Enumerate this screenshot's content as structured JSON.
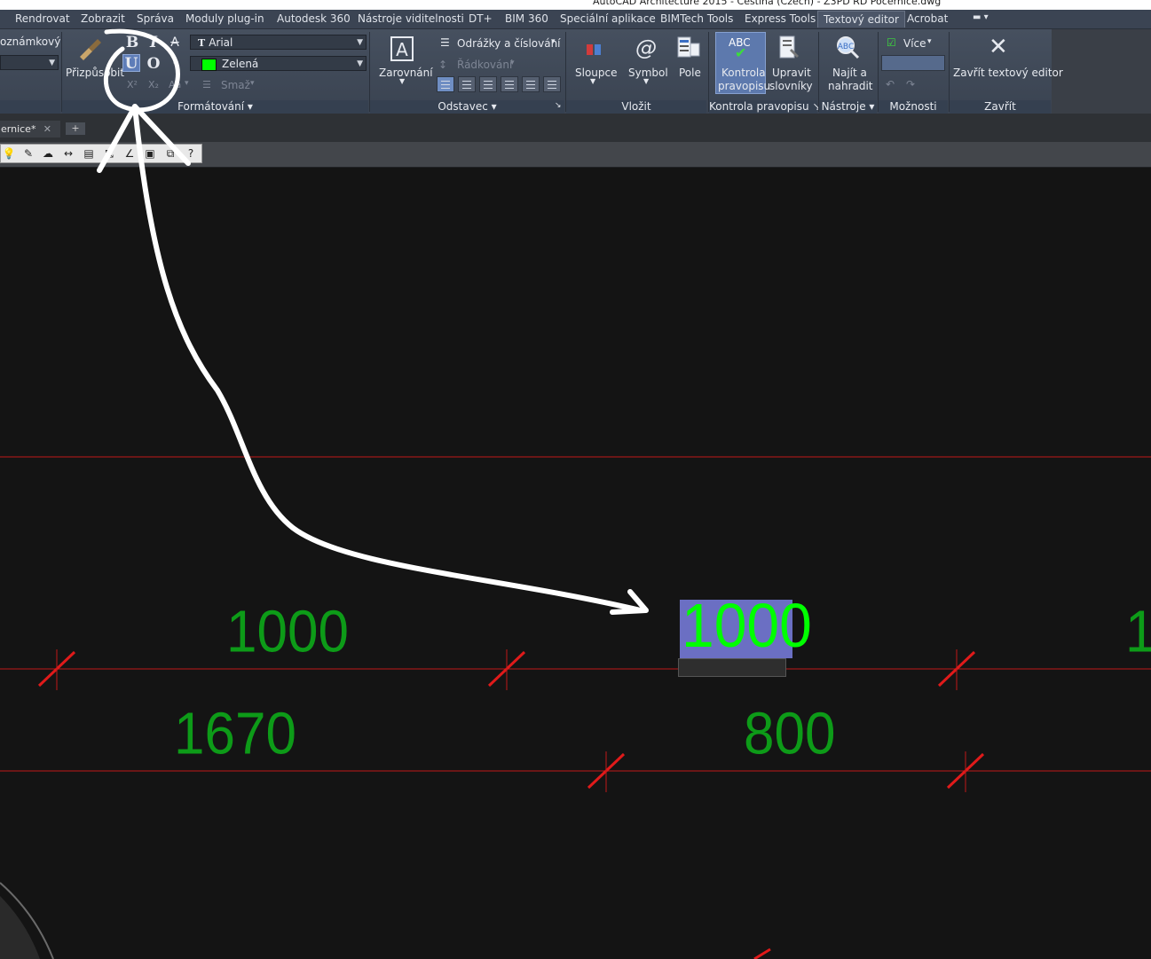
{
  "window": {
    "title": "AutoCAD Architecture 2015 - Čeština (Czech) - Z3PD RD Počernice.dwg"
  },
  "menu": {
    "items": [
      "Rendrovat",
      "Zobrazit",
      "Správa",
      "Moduly plug-in",
      "Autodesk 360",
      "Nástroje viditelnosti",
      "DT+",
      "BIM 360",
      "Speciální aplikace",
      "BIMTech Tools",
      "Express Tools",
      "Textový editor",
      "Acrobat"
    ],
    "active": "Textový editor"
  },
  "ribbon": {
    "style": {
      "annotative_label": "oznámkový"
    },
    "formatting": {
      "match_label": "Přizpůsobit",
      "bold": "B",
      "italic": "I",
      "strike": "A",
      "underline": "U",
      "overline": "O",
      "superscript": "X²",
      "subscript": "X₂",
      "case": "Aa",
      "font_value": "Arial",
      "color_value": "Zelená",
      "color_hex": "#00ff00",
      "clear_label": "Smaž",
      "panel_label": "Formátování"
    },
    "paragraph": {
      "justify_label": "Zarovnání",
      "bullets_label": "Odrážky a číslování",
      "spacing_label": "Řádkování",
      "panel_label": "Odstavec"
    },
    "insert": {
      "columns_label": "Sloupce",
      "symbol_label": "Symbol",
      "field_label": "Pole",
      "panel_label": "Vložit"
    },
    "spell": {
      "check_icon_text": "ABC",
      "check_label_1": "Kontrola",
      "check_label_2": "pravopisu",
      "dict_label_1": "Upravit",
      "dict_label_2": "slovníky",
      "panel_label": "Kontrola pravopisu"
    },
    "tools": {
      "find_label_1": "Najít a",
      "find_label_2": "nahradit",
      "panel_label": "Nástroje"
    },
    "options": {
      "more_label": "Více",
      "panel_label": "Možnosti"
    },
    "close": {
      "close_label": "Zavřít textový editor",
      "panel_label": "Zavřít"
    }
  },
  "tabs": {
    "doc_label": "ernice*"
  },
  "drawing": {
    "dim_1": "1000",
    "dim_2": "1670",
    "dim_3": "800",
    "dim_partial": "1",
    "edit_value": "1000",
    "text_color": "#0d9b18",
    "line_color": "#c01818"
  }
}
